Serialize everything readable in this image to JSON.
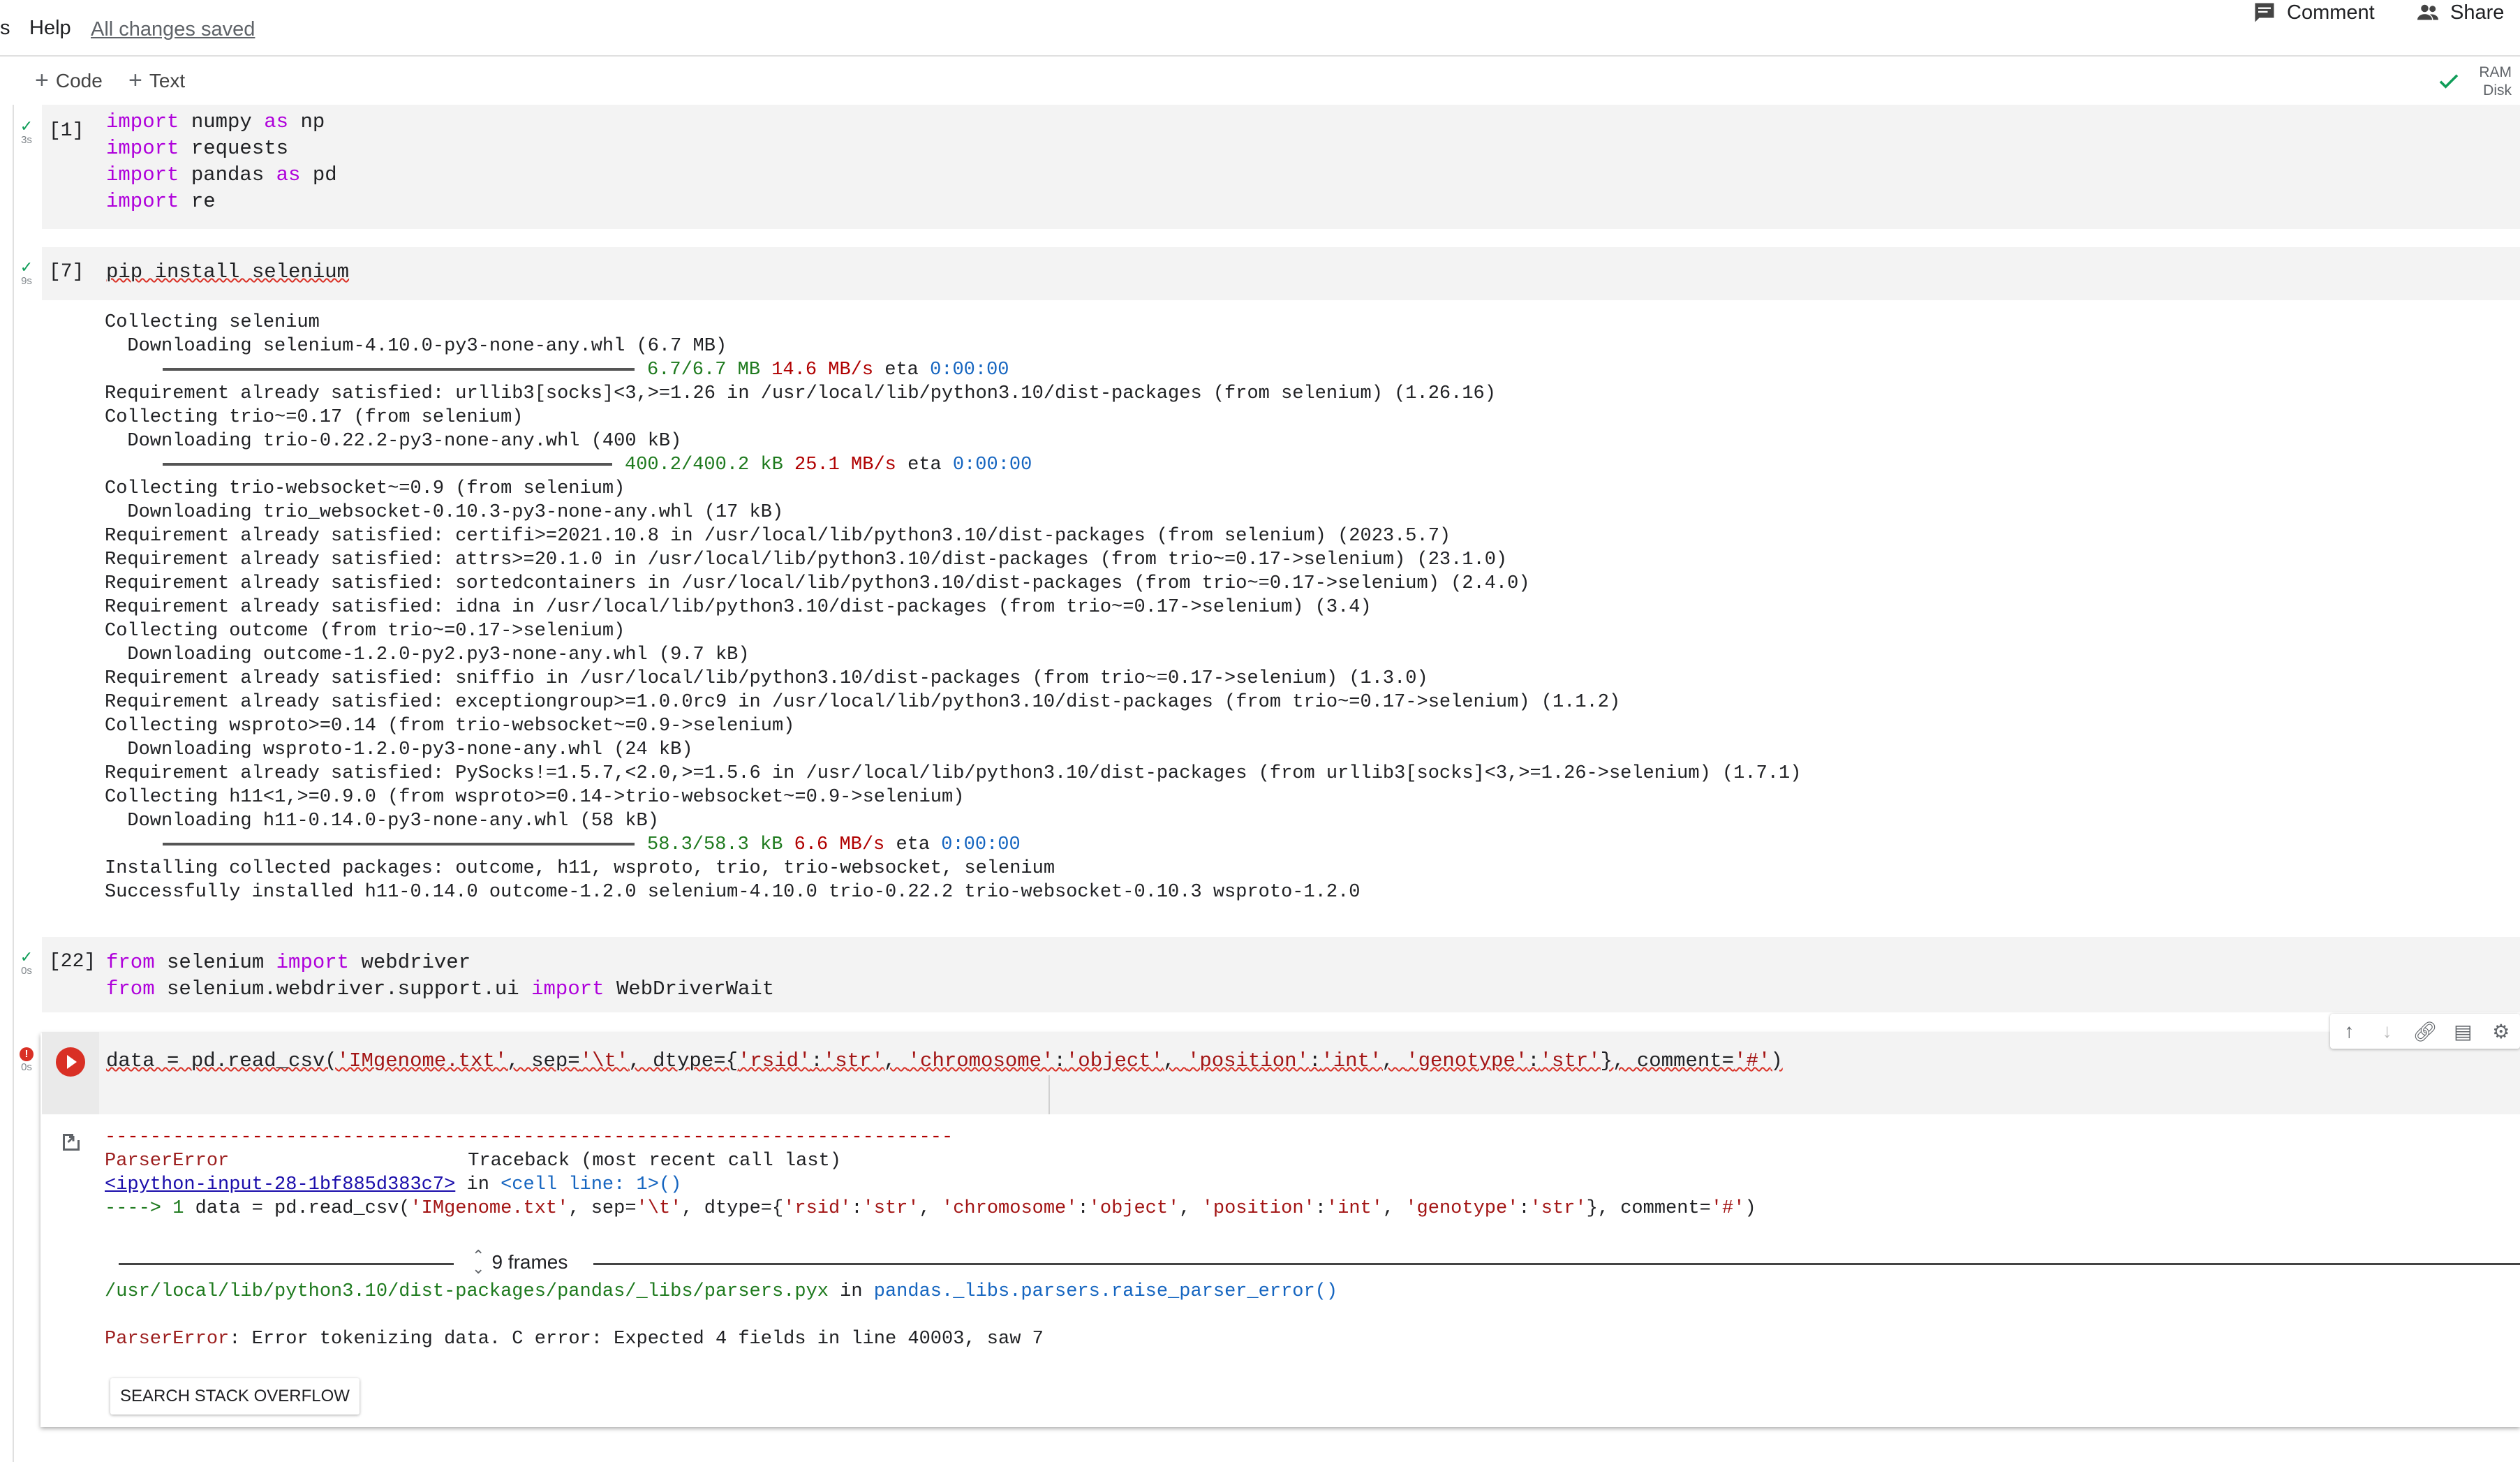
{
  "menu": {
    "partial_item": "s",
    "help": "Help",
    "saved_status": "All changes saved",
    "comment": "Comment",
    "share": "Share"
  },
  "toolbar": {
    "add_code": "Code",
    "add_text": "Text",
    "ram": "RAM",
    "disk": "Disk"
  },
  "cell1": {
    "exec": "[1]",
    "time": "3s",
    "lines": [
      {
        "kw": "import",
        "rest": " numpy ",
        "kw2": "as",
        "rest2": " np"
      },
      {
        "kw": "import",
        "rest": " requests",
        "kw2": "",
        "rest2": ""
      },
      {
        "kw": "import",
        "rest": " pandas ",
        "kw2": "as",
        "rest2": " pd"
      },
      {
        "kw": "import",
        "rest": " re",
        "kw2": "",
        "rest2": ""
      }
    ]
  },
  "cell2": {
    "exec": "[7]",
    "time": "9s",
    "code": "pip install selenium",
    "output": [
      "Collecting selenium",
      "  Downloading selenium-4.10.0-py3-none-any.whl (6.7 MB)",
      "Requirement already satisfied: urllib3[socks]<3,>=1.26 in /usr/local/lib/python3.10/dist-packages (from selenium) (1.26.16)",
      "Collecting trio~=0.17 (from selenium)",
      "  Downloading trio-0.22.2-py3-none-any.whl (400 kB)",
      "Collecting trio-websocket~=0.9 (from selenium)",
      "  Downloading trio_websocket-0.10.3-py3-none-any.whl (17 kB)",
      "Requirement already satisfied: certifi>=2021.10.8 in /usr/local/lib/python3.10/dist-packages (from selenium) (2023.5.7)",
      "Requirement already satisfied: attrs>=20.1.0 in /usr/local/lib/python3.10/dist-packages (from trio~=0.17->selenium) (23.1.0)",
      "Requirement already satisfied: sortedcontainers in /usr/local/lib/python3.10/dist-packages (from trio~=0.17->selenium) (2.4.0)",
      "Requirement already satisfied: idna in /usr/local/lib/python3.10/dist-packages (from trio~=0.17->selenium) (3.4)",
      "Collecting outcome (from trio~=0.17->selenium)",
      "  Downloading outcome-1.2.0-py2.py3-none-any.whl (9.7 kB)",
      "Requirement already satisfied: sniffio in /usr/local/lib/python3.10/dist-packages (from trio~=0.17->selenium) (1.3.0)",
      "Requirement already satisfied: exceptiongroup>=1.0.0rc9 in /usr/local/lib/python3.10/dist-packages (from trio~=0.17->selenium) (1.1.2)",
      "Collecting wsproto>=0.14 (from trio-websocket~=0.9->selenium)",
      "  Downloading wsproto-1.2.0-py3-none-any.whl (24 kB)",
      "Requirement already satisfied: PySocks!=1.5.7,<2.0,>=1.5.6 in /usr/local/lib/python3.10/dist-packages (from urllib3[socks]<3,>=1.26->selenium) (1.7.1)",
      "Collecting h11<1,>=0.9.0 (from wsproto>=0.14->trio-websocket~=0.9->selenium)",
      "  Downloading h11-0.14.0-py3-none-any.whl (58 kB)",
      "Installing collected packages: outcome, h11, wsproto, trio, trio-websocket, selenium",
      "Successfully installed h11-0.14.0 outcome-1.2.0 selenium-4.10.0 trio-0.22.2 trio-websocket-0.10.3 wsproto-1.2.0"
    ],
    "progress": [
      {
        "size": "6.7/6.7 MB",
        "speed": "14.6 MB/s",
        "eta_label": "eta",
        "eta": "0:00:00"
      },
      {
        "size": "400.2/400.2 kB",
        "speed": "25.1 MB/s",
        "eta_label": "eta",
        "eta": "0:00:00"
      },
      {
        "size": "58.3/58.3 kB",
        "speed": "6.6 MB/s",
        "eta_label": "eta",
        "eta": "0:00:00"
      }
    ]
  },
  "cell3": {
    "exec": "[22]",
    "time": "0s",
    "line1": {
      "kw": "from",
      "mod": " selenium ",
      "kw2": "import",
      "name": " webdriver"
    },
    "line2": {
      "kw": "from",
      "mod": " selenium.webdriver.support.ui ",
      "kw2": "import",
      "name": " WebDriverWait"
    }
  },
  "cell4": {
    "time": "0s",
    "code": {
      "p1": "data = pd.read_csv(",
      "s1": "'IMgenome.txt'",
      "p2": ", sep=",
      "s2": "'\\t'",
      "p3": ", dtype={",
      "s3": "'rsid'",
      "p4": ":",
      "s4": "'str'",
      "p5": ", ",
      "s5": "'chromosome'",
      "p6": ":",
      "s6": "'object'",
      "p7": ", ",
      "s7": "'position'",
      "p8": ":",
      "s8": "'int'",
      "p9": ", ",
      "s9": "'genotype'",
      "p10": ":",
      "s10": "'str'",
      "p11": "}, comment=",
      "s11": "'#'",
      "p12": ")"
    },
    "error": {
      "dashes": "---------------------------------------------------------------------------",
      "name": "ParserError",
      "traceback": "Traceback (most recent call last)",
      "input_link": "<ipython-input-28-1bf885d383c7>",
      "in_word": " in ",
      "cell_line": "<cell line: 1>",
      "parens": "()",
      "arrow": "----> 1 ",
      "frames": "9 frames",
      "path": "/usr/local/lib/python3.10/dist-packages/pandas/_libs/parsers.pyx",
      "func": "pandas._libs.parsers.raise_parser_error()",
      "message_name": "ParserError",
      "message": ": Error tokenizing data. C error: Expected 4 fields in line 40003, saw 7",
      "search_button": "SEARCH STACK OVERFLOW"
    }
  },
  "colors": {
    "keyword": "#af00db",
    "string": "#a31515",
    "error": "#d93025",
    "success": "#0f9d58"
  }
}
